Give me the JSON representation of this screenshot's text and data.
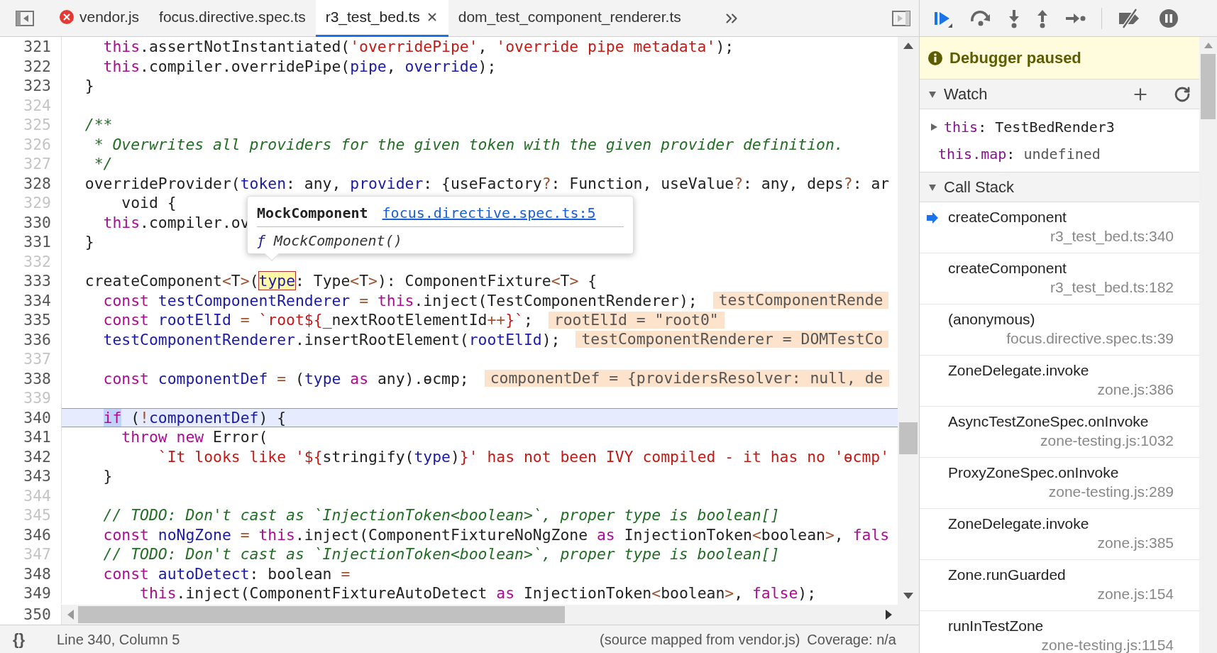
{
  "tabs": {
    "items": [
      {
        "label": "vendor.js",
        "selected": false,
        "error": true
      },
      {
        "label": "focus.directive.spec.ts",
        "selected": false,
        "error": false
      },
      {
        "label": "r3_test_bed.ts",
        "selected": true,
        "error": false
      },
      {
        "label": "dom_test_component_renderer.ts",
        "selected": false,
        "error": false
      }
    ]
  },
  "editor": {
    "lines": [
      {
        "number": "321",
        "dim": false,
        "current": false,
        "tokens": [
          {
            "text": "    this",
            "kind": "keyword"
          },
          {
            "text": ".assertNotInstantiated(",
            "kind": "plain"
          },
          {
            "text": "'overridePipe'",
            "kind": "string"
          },
          {
            "text": ", ",
            "kind": "plain"
          },
          {
            "text": "'override pipe metadata'",
            "kind": "string"
          },
          {
            "text": ");",
            "kind": "plain"
          }
        ]
      },
      {
        "number": "322",
        "dim": false,
        "current": false,
        "tokens": [
          {
            "text": "    this",
            "kind": "keyword"
          },
          {
            "text": ".compiler.overridePipe(",
            "kind": "plain"
          },
          {
            "text": "pipe",
            "kind": "variable"
          },
          {
            "text": ", ",
            "kind": "plain"
          },
          {
            "text": "override",
            "kind": "variable"
          },
          {
            "text": ");",
            "kind": "plain"
          }
        ]
      },
      {
        "number": "323",
        "dim": false,
        "current": false,
        "tokens": [
          {
            "text": "  }",
            "kind": "plain"
          }
        ]
      },
      {
        "number": "324",
        "dim": true,
        "current": false
      },
      {
        "number": "325",
        "dim": true,
        "current": false,
        "tokens": [
          {
            "text": "  /**",
            "kind": "comment"
          }
        ]
      },
      {
        "number": "326",
        "dim": true,
        "current": false,
        "tokens": [
          {
            "text": "   * Overwrites all providers for the given token with the given provider definition.",
            "kind": "comment"
          }
        ]
      },
      {
        "number": "327",
        "dim": true,
        "current": false,
        "tokens": [
          {
            "text": "   */",
            "kind": "comment"
          }
        ]
      },
      {
        "number": "328",
        "dim": false,
        "current": false,
        "tokens": [
          {
            "text": "  overrideProvider(",
            "kind": "plain"
          },
          {
            "text": "token",
            "kind": "variable"
          },
          {
            "text": ": any, ",
            "kind": "plain"
          },
          {
            "text": "provider",
            "kind": "variable"
          },
          {
            "text": ": {useFactory",
            "kind": "plain"
          },
          {
            "text": "?",
            "kind": "operator"
          },
          {
            "text": ": Function, useValue",
            "kind": "plain"
          },
          {
            "text": "?",
            "kind": "operator"
          },
          {
            "text": ": any, deps",
            "kind": "plain"
          },
          {
            "text": "?",
            "kind": "operator"
          },
          {
            "text": ": ar",
            "kind": "plain"
          }
        ]
      },
      {
        "number": "329",
        "dim": true,
        "current": false,
        "tokens": [
          {
            "text": "      void {",
            "kind": "plain"
          }
        ]
      },
      {
        "number": "330",
        "dim": false,
        "current": false,
        "tokens": [
          {
            "text": "    this",
            "kind": "keyword"
          },
          {
            "text": ".compiler.ov",
            "kind": "plain"
          }
        ]
      },
      {
        "number": "331",
        "dim": false,
        "current": false,
        "tokens": [
          {
            "text": "  }",
            "kind": "plain"
          }
        ]
      },
      {
        "number": "332",
        "dim": true,
        "current": false
      },
      {
        "number": "333",
        "dim": false,
        "current": false,
        "tokens": [
          {
            "text": "  createComponent",
            "kind": "plain"
          },
          {
            "text": "<",
            "kind": "operator"
          },
          {
            "text": "T",
            "kind": "plain"
          },
          {
            "text": ">",
            "kind": "operator"
          },
          {
            "text": "(",
            "kind": "plain"
          },
          {
            "text": "type",
            "kind": "hovered"
          },
          {
            "text": ": Type",
            "kind": "plain"
          },
          {
            "text": "<",
            "kind": "operator"
          },
          {
            "text": "T",
            "kind": "plain"
          },
          {
            "text": ">",
            "kind": "operator"
          },
          {
            "text": "): ComponentFixture",
            "kind": "plain"
          },
          {
            "text": "<",
            "kind": "operator"
          },
          {
            "text": "T",
            "kind": "plain"
          },
          {
            "text": ">",
            "kind": "operator"
          },
          {
            "text": " {",
            "kind": "plain"
          }
        ]
      },
      {
        "number": "334",
        "dim": false,
        "current": false,
        "tokens": [
          {
            "text": "    const ",
            "kind": "keyword"
          },
          {
            "text": "testComponentRenderer ",
            "kind": "variable"
          },
          {
            "text": "= ",
            "kind": "operator"
          },
          {
            "text": "this",
            "kind": "keyword"
          },
          {
            "text": ".inject(TestComponentRenderer);",
            "kind": "plain"
          }
        ],
        "inline_value": "testComponentRende"
      },
      {
        "number": "335",
        "dim": false,
        "current": false,
        "tokens": [
          {
            "text": "    const ",
            "kind": "keyword"
          },
          {
            "text": "rootElId ",
            "kind": "variable"
          },
          {
            "text": "= ",
            "kind": "operator"
          },
          {
            "text": "`root${",
            "kind": "string"
          },
          {
            "text": "_nextRootElementId",
            "kind": "plain"
          },
          {
            "text": "++",
            "kind": "operator"
          },
          {
            "text": "}`",
            "kind": "string"
          },
          {
            "text": ";",
            "kind": "plain"
          }
        ],
        "inline_value": "rootElId = \"root0\""
      },
      {
        "number": "336",
        "dim": false,
        "current": false,
        "tokens": [
          {
            "text": "    testComponentRenderer",
            "kind": "variable"
          },
          {
            "text": ".insertRootElement(",
            "kind": "plain"
          },
          {
            "text": "rootElId",
            "kind": "variable"
          },
          {
            "text": ");",
            "kind": "plain"
          }
        ],
        "inline_value": "testComponentRenderer = DOMTestCo"
      },
      {
        "number": "337",
        "dim": true,
        "current": false
      },
      {
        "number": "338",
        "dim": false,
        "current": false,
        "tokens": [
          {
            "text": "    const ",
            "kind": "keyword"
          },
          {
            "text": "componentDef ",
            "kind": "variable"
          },
          {
            "text": "= ",
            "kind": "operator"
          },
          {
            "text": "(",
            "kind": "plain"
          },
          {
            "text": "type ",
            "kind": "variable"
          },
          {
            "text": "as",
            "kind": "keyword"
          },
          {
            "text": " any).ɵcmp;",
            "kind": "plain"
          }
        ],
        "inline_value": "componentDef = {providersResolver: null, de"
      },
      {
        "number": "339",
        "dim": true,
        "current": false
      },
      {
        "number": "340",
        "dim": false,
        "current": true,
        "tokens": [
          {
            "text": "    if",
            "kind": "paused"
          },
          {
            "text": " (",
            "kind": "plain"
          },
          {
            "text": "!",
            "kind": "operator"
          },
          {
            "text": "componentDef",
            "kind": "variable"
          },
          {
            "text": ") {",
            "kind": "plain"
          }
        ]
      },
      {
        "number": "341",
        "dim": false,
        "current": false,
        "tokens": [
          {
            "text": "      throw new",
            "kind": "keyword"
          },
          {
            "text": " Error(",
            "kind": "plain"
          }
        ]
      },
      {
        "number": "342",
        "dim": false,
        "current": false,
        "tokens": [
          {
            "text": "          `It looks like '${",
            "kind": "string"
          },
          {
            "text": "stringify(",
            "kind": "plain"
          },
          {
            "text": "type",
            "kind": "variable"
          },
          {
            "text": ")",
            "kind": "plain"
          },
          {
            "text": "}' has not been IVY compiled - it has no 'ɵcmp'",
            "kind": "string"
          }
        ]
      },
      {
        "number": "343",
        "dim": false,
        "current": false,
        "tokens": [
          {
            "text": "    }",
            "kind": "plain"
          }
        ]
      },
      {
        "number": "344",
        "dim": true,
        "current": false
      },
      {
        "number": "345",
        "dim": true,
        "current": false,
        "tokens": [
          {
            "text": "    // TODO: Don't cast as `InjectionToken<boolean>`, proper type is boolean[]",
            "kind": "comment"
          }
        ]
      },
      {
        "number": "346",
        "dim": false,
        "current": false,
        "tokens": [
          {
            "text": "    const ",
            "kind": "keyword"
          },
          {
            "text": "noNgZone ",
            "kind": "variable"
          },
          {
            "text": "= ",
            "kind": "operator"
          },
          {
            "text": "this",
            "kind": "keyword"
          },
          {
            "text": ".inject(ComponentFixtureNoNgZone ",
            "kind": "plain"
          },
          {
            "text": "as",
            "kind": "keyword"
          },
          {
            "text": " InjectionToken",
            "kind": "plain"
          },
          {
            "text": "<",
            "kind": "operator"
          },
          {
            "text": "boolean",
            "kind": "plain"
          },
          {
            "text": ">",
            "kind": "operator"
          },
          {
            "text": ", ",
            "kind": "plain"
          },
          {
            "text": "fals",
            "kind": "keyword"
          }
        ]
      },
      {
        "number": "347",
        "dim": true,
        "current": false,
        "tokens": [
          {
            "text": "    // TODO: Don't cast as `InjectionToken<boolean>`, proper type is boolean[]",
            "kind": "comment"
          }
        ]
      },
      {
        "number": "348",
        "dim": false,
        "current": false,
        "tokens": [
          {
            "text": "    const ",
            "kind": "keyword"
          },
          {
            "text": "autoDetect",
            "kind": "variable"
          },
          {
            "text": ": boolean ",
            "kind": "plain"
          },
          {
            "text": "=",
            "kind": "operator"
          }
        ]
      },
      {
        "number": "349",
        "dim": false,
        "current": false,
        "tokens": [
          {
            "text": "        this",
            "kind": "keyword"
          },
          {
            "text": ".inject(ComponentFixtureAutoDetect ",
            "kind": "plain"
          },
          {
            "text": "as",
            "kind": "keyword"
          },
          {
            "text": " InjectionToken",
            "kind": "plain"
          },
          {
            "text": "<",
            "kind": "operator"
          },
          {
            "text": "boolean",
            "kind": "plain"
          },
          {
            "text": ">",
            "kind": "operator"
          },
          {
            "text": ", ",
            "kind": "plain"
          },
          {
            "text": "false",
            "kind": "keyword"
          },
          {
            "text": ");",
            "kind": "plain"
          }
        ]
      },
      {
        "number": "350",
        "dim": false,
        "current": false
      }
    ],
    "hover_popup": {
      "title": "MockComponent",
      "link": "focus.directive.spec.ts:5",
      "keyword": "ƒ",
      "signature": "MockComponent()"
    }
  },
  "status_bar": {
    "format_button": "{}",
    "position": "Line 340, Column 5",
    "source": "(source mapped from vendor.js)",
    "coverage": "Coverage: n/a"
  },
  "debugger": {
    "banner": "Debugger paused",
    "watch": {
      "title": "Watch",
      "expanded": true,
      "items": [
        {
          "expression": "this",
          "separator": ":",
          "value": "TestBedRender3",
          "expandable": true
        },
        {
          "expression": "this.map",
          "separator": ":",
          "value": "undefined",
          "expandable": false
        }
      ]
    },
    "call_stack": {
      "title": "Call Stack",
      "expanded": true,
      "frames": [
        {
          "name": "createComponent",
          "location": "r3_test_bed.ts:340",
          "selected": true
        },
        {
          "name": "createComponent",
          "location": "r3_test_bed.ts:182",
          "selected": false
        },
        {
          "name": "(anonymous)",
          "location": "focus.directive.spec.ts:39",
          "selected": false
        },
        {
          "name": "ZoneDelegate.invoke",
          "location": "zone.js:386",
          "selected": false
        },
        {
          "name": "AsyncTestZoneSpec.onInvoke",
          "location": "zone-testing.js:1032",
          "selected": false
        },
        {
          "name": "ProxyZoneSpec.onInvoke",
          "location": "zone-testing.js:289",
          "selected": false
        },
        {
          "name": "ZoneDelegate.invoke",
          "location": "zone.js:385",
          "selected": false
        },
        {
          "name": "Zone.runGuarded",
          "location": "zone.js:154",
          "selected": false
        },
        {
          "name": "runInTestZone",
          "location": "zone-testing.js:1154",
          "selected": false
        }
      ]
    }
  }
}
